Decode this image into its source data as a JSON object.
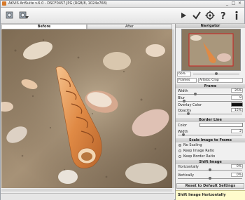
{
  "window": {
    "title": "AKVIS ArtSuite v.6.0 - DSCF0457.JPG (RGB/8, 1024x768)",
    "minimize_glyph": "_",
    "maximize_glyph": "□",
    "close_glyph": "×"
  },
  "toolbar": {
    "left_icons": [
      "open-image-icon",
      "save-image-icon"
    ],
    "right_icons": [
      "run-icon",
      "apply-icon",
      "settings-icon",
      "help-icon",
      "info-icon"
    ]
  },
  "tabs": [
    {
      "label": "Before",
      "active": true
    },
    {
      "label": "After",
      "active": false
    }
  ],
  "navigator": {
    "header": "Navigator",
    "zoom": "66%"
  },
  "effect": {
    "category": "Frames",
    "frame_type": "Artistic Crop"
  },
  "frame": {
    "header": "Frame",
    "width_label": "Width",
    "width_value": "26%",
    "width_level": 0.26,
    "blur_label": "Blur",
    "blur_value": "8",
    "blur_level": 0.08,
    "overlay_color_label": "Overlay Color",
    "overlay_color": "#111111",
    "opacity_label": "Opacity",
    "opacity_value": "15%",
    "opacity_level": 0.15
  },
  "border_line": {
    "header": "Border Line",
    "color_label": "Color",
    "color": "#ffffff",
    "width_label": "Width",
    "width_value": "2"
  },
  "scale": {
    "header": "Scale Image to Frame",
    "options": [
      "No Scaling",
      "Keep Image Ratio",
      "Keep Border Ratio"
    ],
    "selected": 0
  },
  "shift": {
    "header": "Shift Image",
    "horizontally_label": "Horizontally",
    "horizontally_value": "0%",
    "vertically_label": "Vertically",
    "vertically_value": "0%"
  },
  "reset_label": "Reset to Default Settings",
  "hint_text": "Shift Image Horizontally",
  "colors": {
    "accent": "#d77a2a",
    "hint_background": "#fffbcc"
  }
}
